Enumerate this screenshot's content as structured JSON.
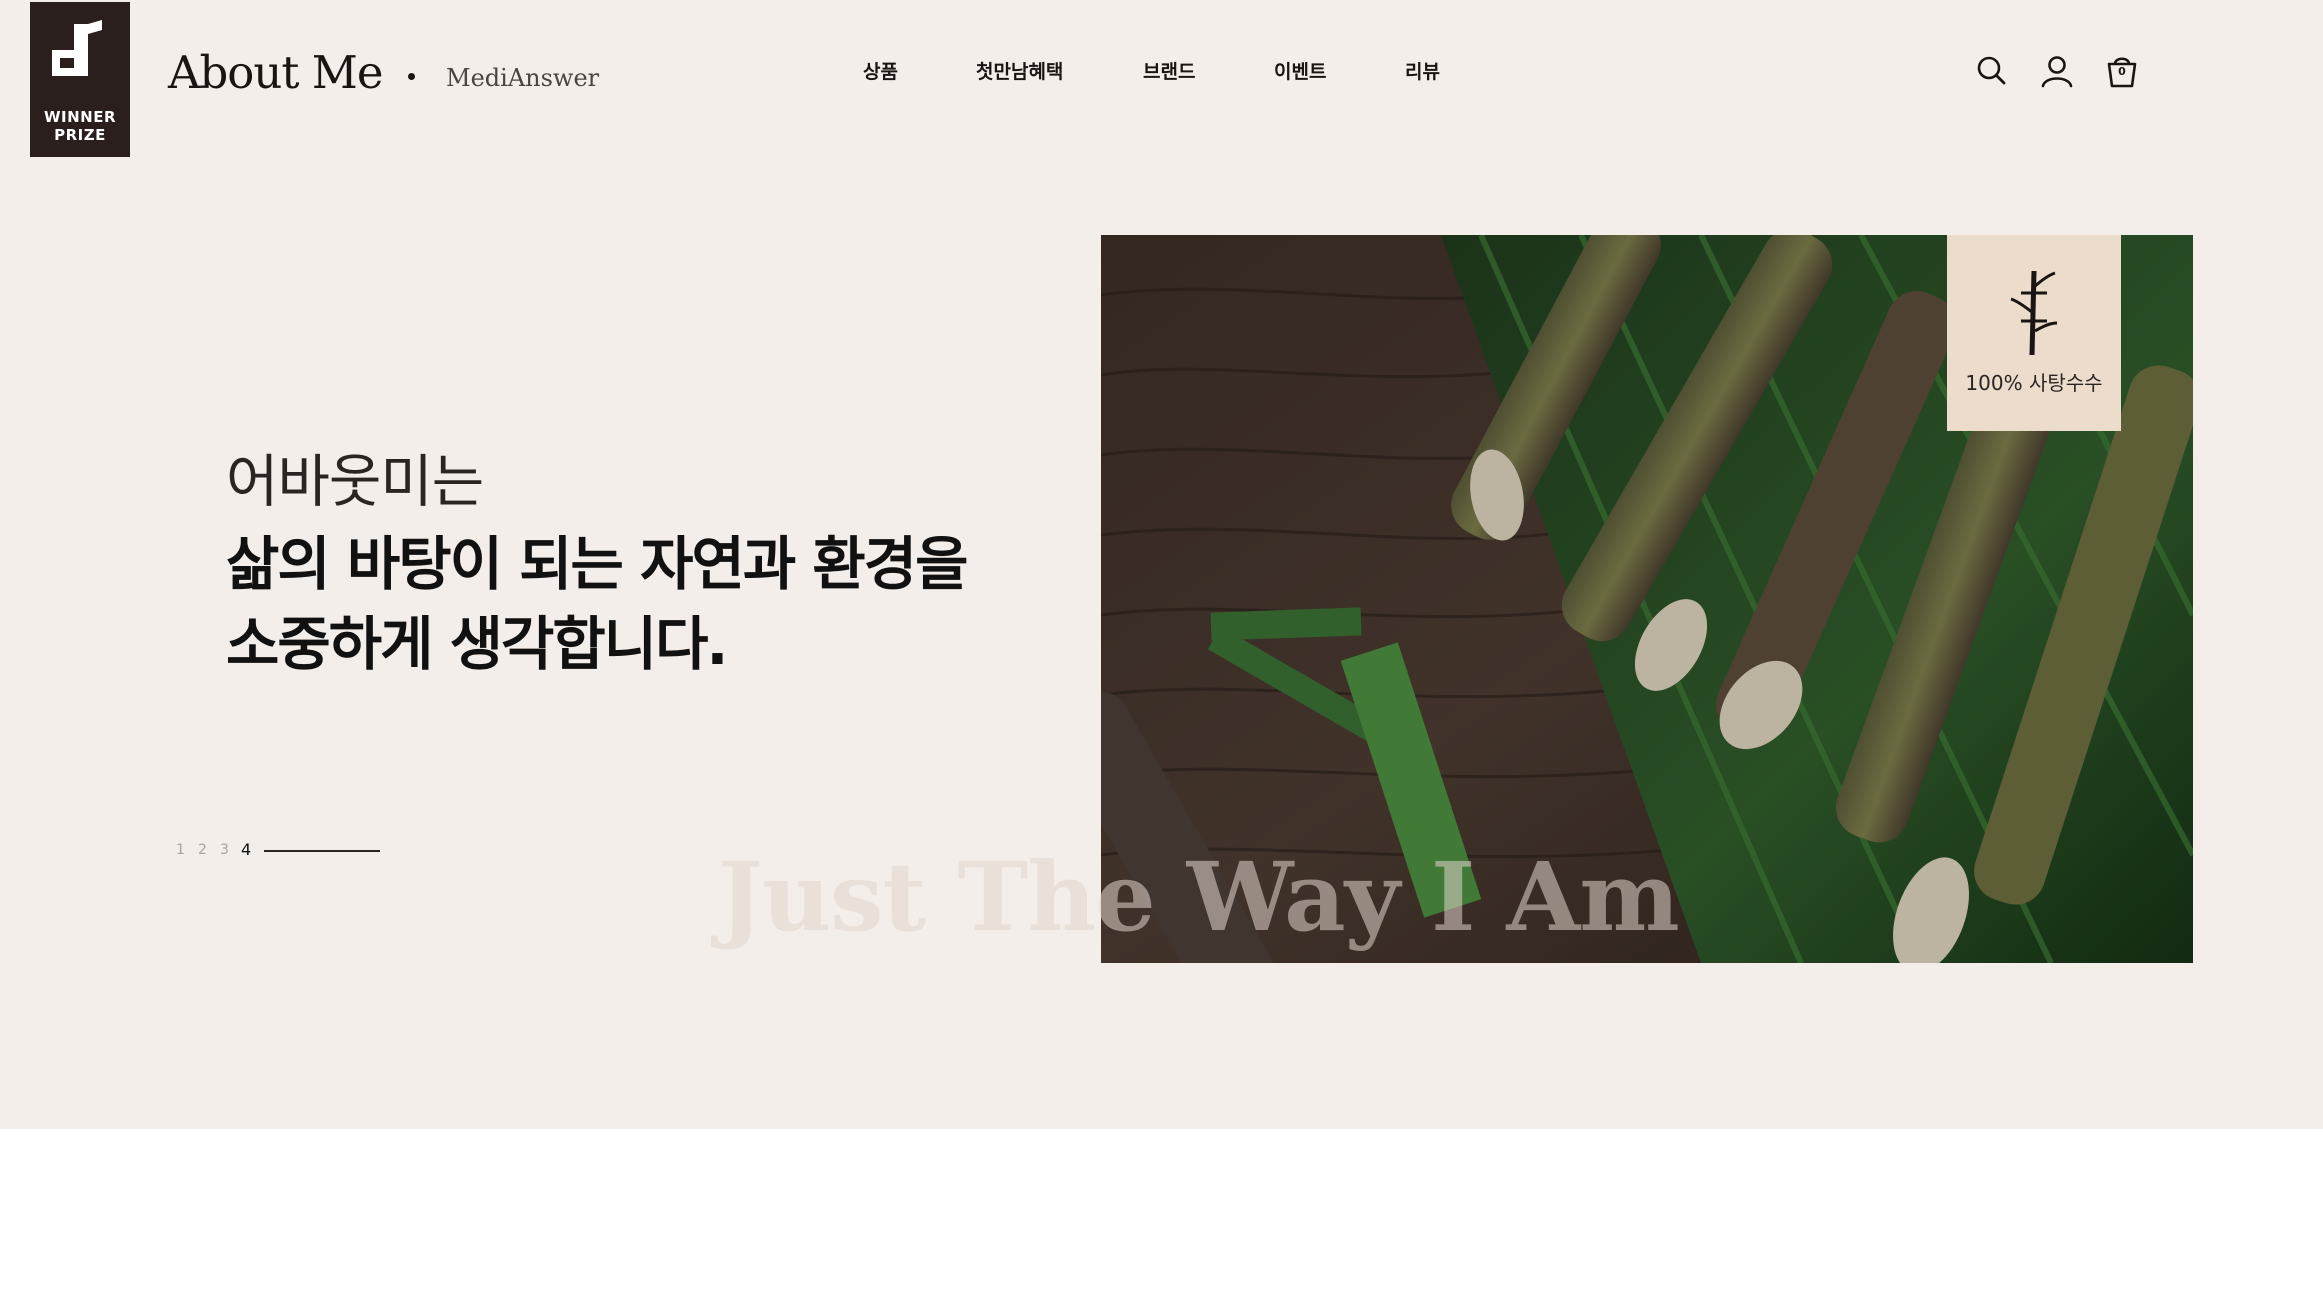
{
  "header": {
    "badge_text": "WINNER\nPRIZE",
    "brand": "About Me",
    "partner": "MediAnswer",
    "nav": [
      "상품",
      "첫만남혜택",
      "브랜드",
      "이벤트",
      "리뷰"
    ],
    "icons": [
      "search-icon",
      "user-icon",
      "cart-icon"
    ],
    "cart_count": "0"
  },
  "hero": {
    "intro": "어바웃미는",
    "headline_line1": "삶의 바탕이 되는 자연과 환경을",
    "headline_line2": "소중하게 생각합니다.",
    "pager": [
      "1",
      "2",
      "3",
      "4"
    ],
    "pager_active": "4",
    "tag_label": "100% 사탕수수",
    "tag_icon": "sugarcane-icon",
    "watermark": "Just The Way I Am"
  },
  "colors": {
    "hero_bg": "#f4eeea",
    "badge_bg": "#2a1f1d",
    "tag_bg": "#ebdccb"
  }
}
